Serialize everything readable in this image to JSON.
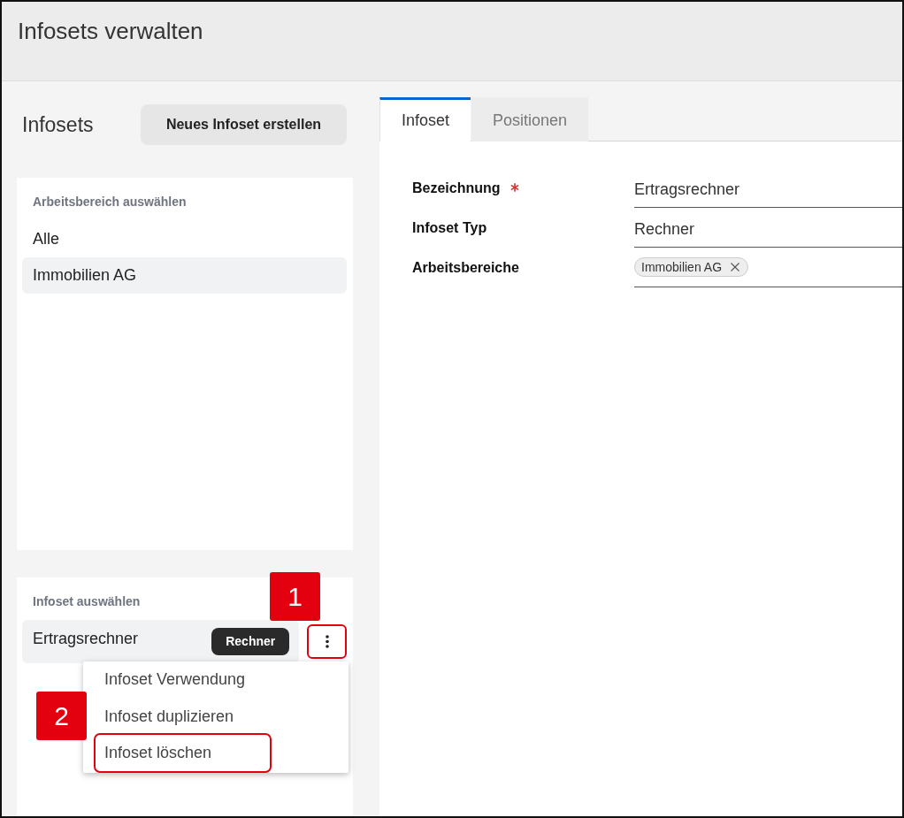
{
  "header": {
    "title": "Infosets verwalten"
  },
  "sidebar": {
    "title": "Infosets",
    "create_button": "Neues Infoset erstellen",
    "workspace_list": {
      "label": "Arbeitsbereich auswählen",
      "items": [
        {
          "label": "Alle",
          "selected": false
        },
        {
          "label": "Immobilien AG",
          "selected": true
        }
      ]
    },
    "infoset_list": {
      "label": "Infoset auswählen",
      "items": [
        {
          "label": "Ertragsrechner",
          "type_badge": "Rechner",
          "selected": true,
          "menu_button": {
            "highlighted": true,
            "annotation": "1"
          }
        }
      ]
    },
    "context_menu": {
      "annotation": "2",
      "items": [
        {
          "label": "Infoset Verwendung",
          "highlighted": false
        },
        {
          "label": "Infoset duplizieren",
          "highlighted": false
        },
        {
          "label": "Infoset löschen",
          "highlighted": true
        }
      ]
    }
  },
  "tabs": [
    {
      "label": "Infoset",
      "selected": true
    },
    {
      "label": "Positionen",
      "selected": false
    }
  ],
  "form": {
    "fields": [
      {
        "label": "Bezeichnung",
        "required": true,
        "kind": "text",
        "value": "Ertragsrechner"
      },
      {
        "label": "Infoset Typ",
        "required": false,
        "kind": "text",
        "value": "Rechner"
      },
      {
        "label": "Arbeitsbereiche",
        "required": false,
        "kind": "chips",
        "chips": [
          "Immobilien AG"
        ]
      }
    ]
  }
}
